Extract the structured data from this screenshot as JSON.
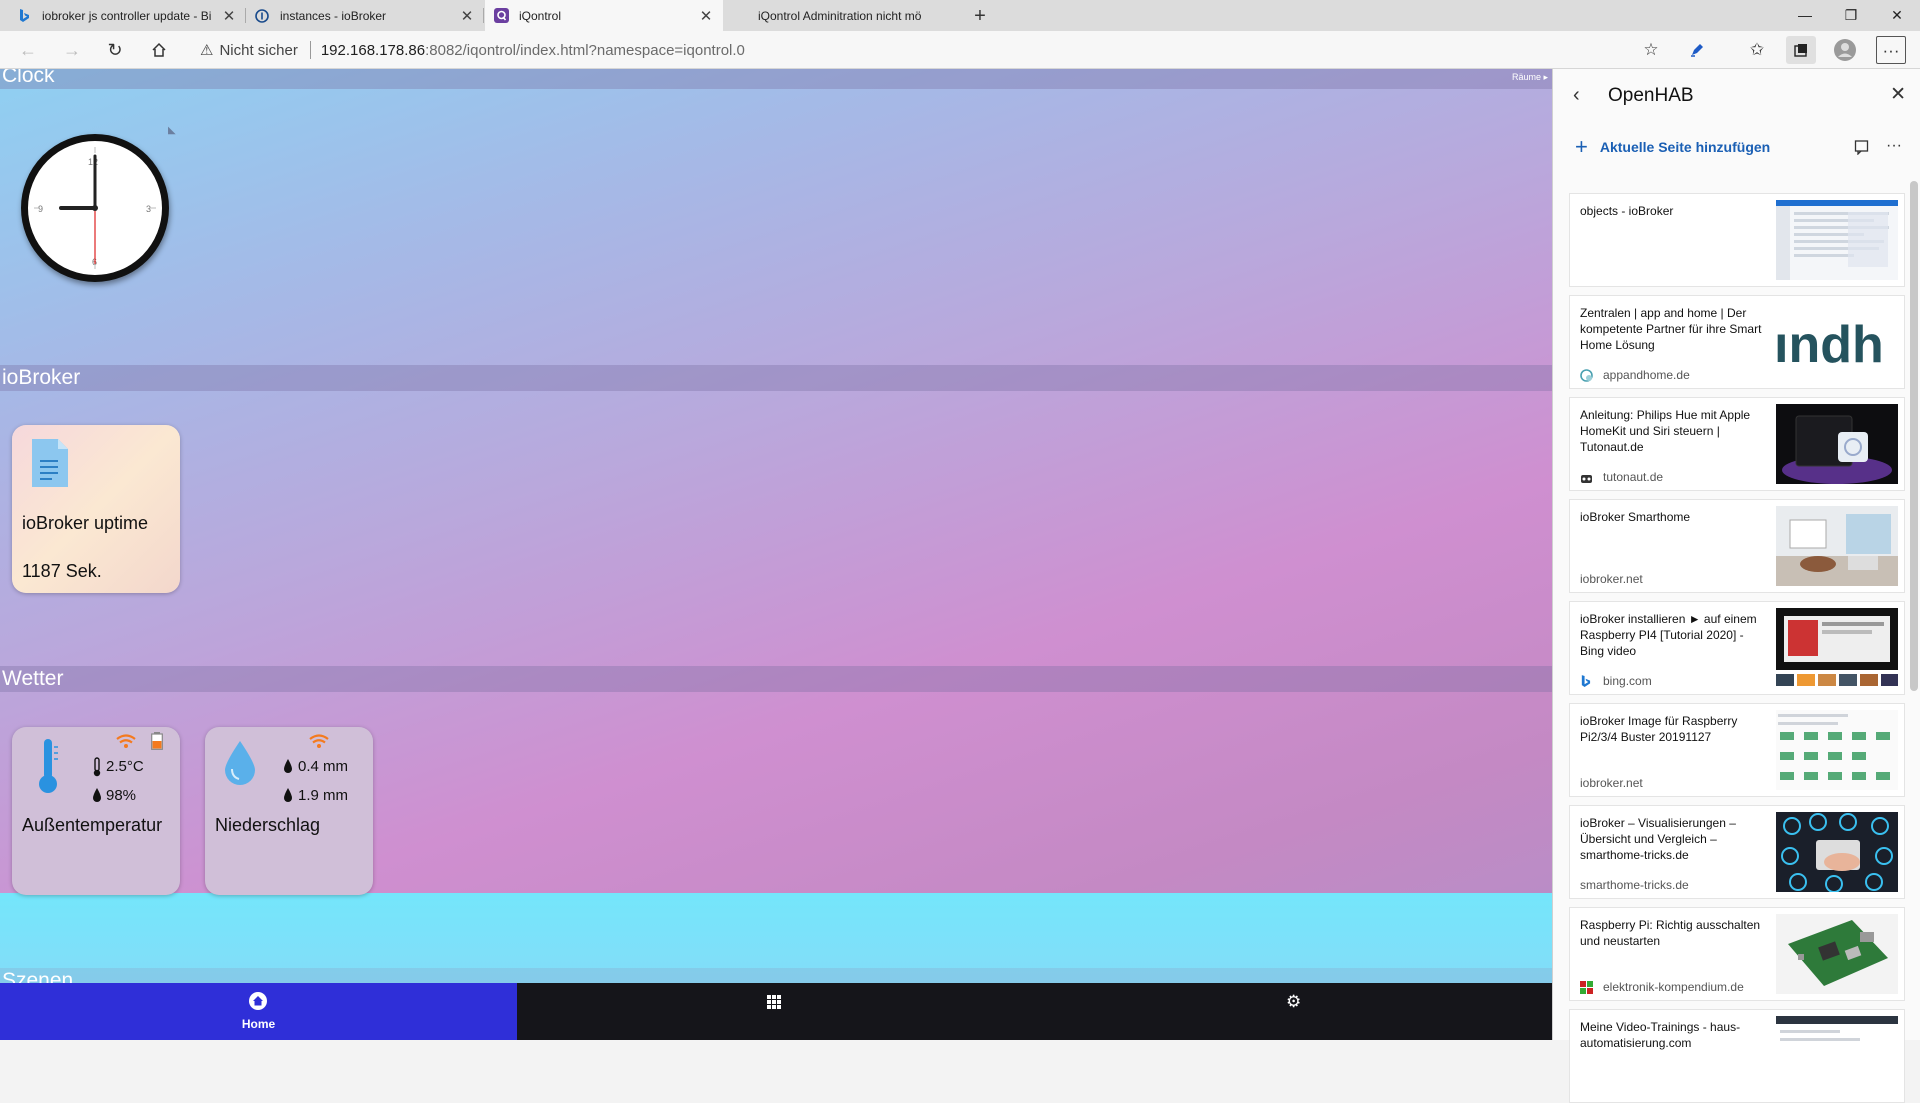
{
  "browser": {
    "tabs": [
      {
        "title": "iobroker js controller update - Bi",
        "favicon": "bing-icon"
      },
      {
        "title": "instances - ioBroker",
        "favicon": "iobroker-icon"
      },
      {
        "title": "iQontrol",
        "favicon": "iqontrol-icon",
        "active": true
      },
      {
        "title": "iQontrol Adminitration nicht mö",
        "favicon": "none"
      }
    ],
    "security_label": "Nicht sicher",
    "url_host": "192.168.178.86",
    "url_rest": ":8082/iqontrol/index.html?namespace=iqontrol.0"
  },
  "app": {
    "rooms_label": "Räume ▸",
    "sections": {
      "clock": "Clock",
      "iobroker": "ioBroker",
      "wetter": "Wetter",
      "szenen": "Szenen"
    },
    "clock": {
      "hour": 9,
      "minute": 0,
      "second": 30
    },
    "tiles": {
      "uptime": {
        "name": "ioBroker uptime",
        "value": "1187 Sek."
      },
      "temp": {
        "name": "Außentemperatur",
        "temperature": "2.5°C",
        "humidity": "98%"
      },
      "rain": {
        "name": "Niederschlag",
        "value1": "0.4 mm",
        "value2": "1.9 mm"
      }
    },
    "tabbar": {
      "home_label": "Home"
    }
  },
  "collections": {
    "title": "OpenHAB",
    "add_label": "Aktuelle Seite hinzufügen",
    "items": [
      {
        "title": "objects - ioBroker",
        "site": ""
      },
      {
        "title": "Zentralen | app and home | Der kompetente Partner für ihre Smart Home Lösung",
        "site": "appandhome.de"
      },
      {
        "title": "Anleitung: Philips Hue mit Apple HomeKit und Siri steuern | Tutonaut.de",
        "site": "tutonaut.de"
      },
      {
        "title": "ioBroker Smarthome",
        "site": "iobroker.net"
      },
      {
        "title": "ioBroker installieren ► auf einem Raspberry PI4 [Tutorial 2020] - Bing video",
        "site": "bing.com"
      },
      {
        "title": "ioBroker Image für Raspberry Pi2/3/4 Buster 20191127",
        "site": "iobroker.net"
      },
      {
        "title": "ioBroker – Visualisierungen – Übersicht und Vergleich – smarthome-tricks.de",
        "site": "smarthome-tricks.de"
      },
      {
        "title": "Raspberry Pi: Richtig ausschalten und neustarten",
        "site": "elektronik-kompendium.de"
      },
      {
        "title": "Meine Video-Trainings - haus-automatisierung.com",
        "site": ""
      }
    ]
  },
  "colors": {
    "home_tab": "#2f2fd8",
    "link_blue": "#1a5fb4",
    "wifi_orange": "#f47a1f"
  }
}
